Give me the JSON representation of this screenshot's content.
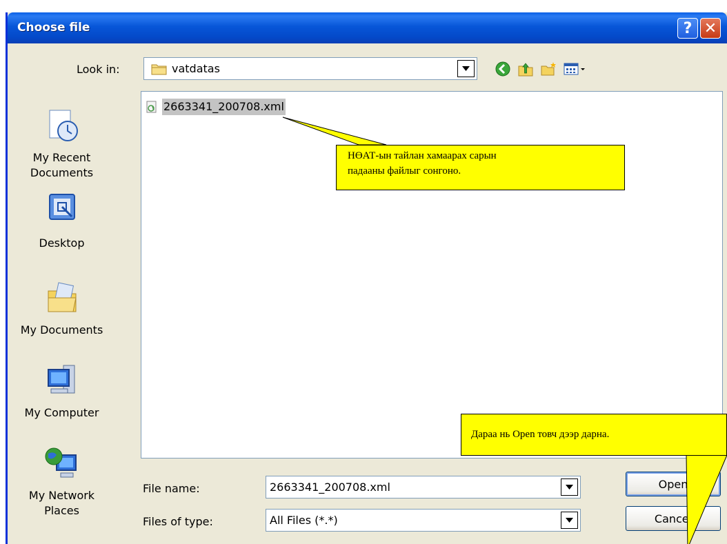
{
  "dialog": {
    "title": "Choose file",
    "help_glyph": "?",
    "close_glyph": "✕"
  },
  "lookin": {
    "label": "Look in:",
    "value": "vatdatas"
  },
  "toolbar": {
    "icons": [
      "back-icon",
      "up-folder-icon",
      "new-folder-icon",
      "view-menu-icon"
    ]
  },
  "places": [
    {
      "label": "My Recent Documents",
      "icon": "recent-documents-icon"
    },
    {
      "label": "Desktop",
      "icon": "desktop-icon"
    },
    {
      "label": "My Documents",
      "icon": "my-documents-icon"
    },
    {
      "label": "My Computer",
      "icon": "my-computer-icon"
    },
    {
      "label": "My Network Places",
      "icon": "network-places-icon"
    }
  ],
  "files": [
    {
      "name": "2663341_200708.xml",
      "icon": "xml-file-icon",
      "selected": true
    }
  ],
  "filename": {
    "label": "File name:",
    "value": "2663341_200708.xml"
  },
  "filetype": {
    "label": "Files of type:",
    "value": "All Files (*.*)"
  },
  "buttons": {
    "open": "Open",
    "cancel": "Cancel"
  },
  "callouts": {
    "select_file_line1": "НӨАТ-ын тайлан хамаарах сарын",
    "select_file_line2": "падааны файлыг сонгоно.",
    "open_hint": "Дараа нь Open товч дээр дарна."
  },
  "colors": {
    "titlebar": "#0756d8",
    "dialog_bg": "#ece9d8",
    "callout_bg": "#ffff00",
    "selection_bg": "#c3c3c3"
  }
}
